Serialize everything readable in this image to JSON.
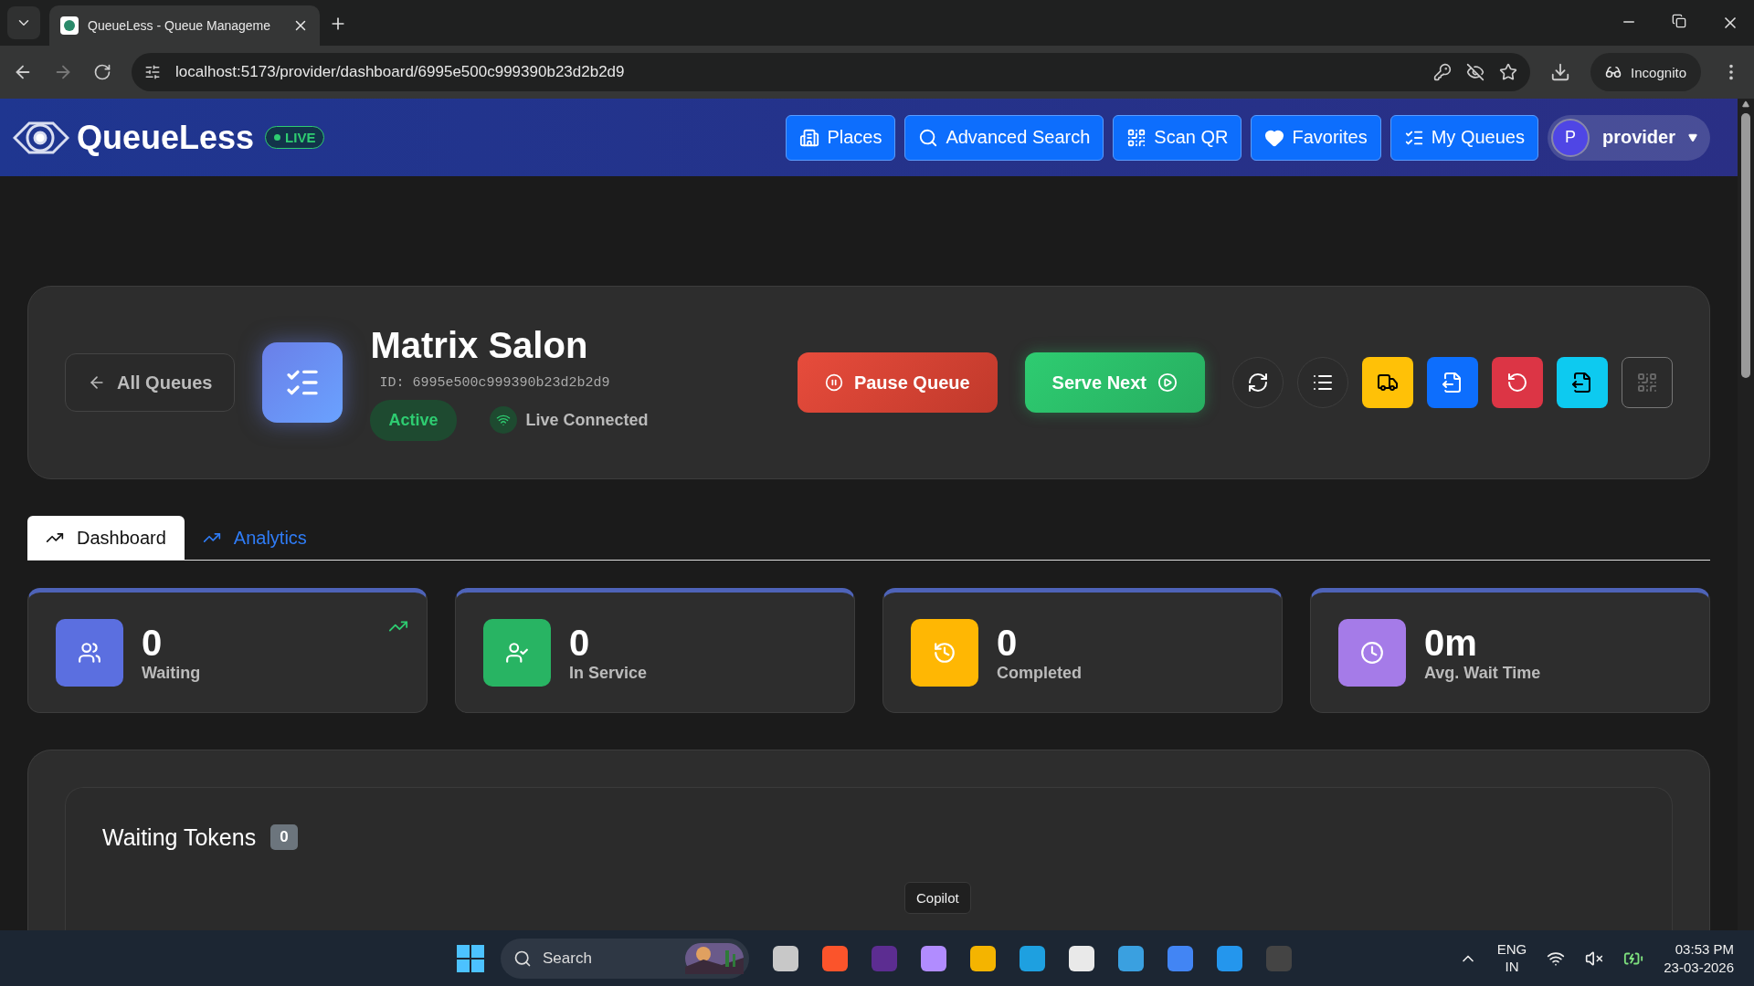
{
  "browser": {
    "tab_title": "QueueLess - Queue Manageme",
    "url": "localhost:5173/provider/dashboard/6995e500c999390b23d2b2d9",
    "profile": "Incognito"
  },
  "navbar": {
    "brand": "QueueLess",
    "badge": "LIVE",
    "buttons": [
      "Places",
      "Advanced Search",
      "Scan QR",
      "Favorites",
      "My Queues"
    ],
    "user_initial": "P",
    "user_name": "provider"
  },
  "queue": {
    "back": "All Queues",
    "name": "Matrix Salon",
    "id": "ID: 6995e500c999390b23d2b2d9",
    "status": "Active",
    "connection": "Live Connected",
    "pause": "Pause Queue",
    "serve": "Serve Next",
    "tools": [
      {
        "kind": "round",
        "color": "#2b2b2b"
      },
      {
        "kind": "round",
        "color": "#2b2b2b"
      },
      {
        "kind": "square",
        "color": "#ffc107"
      },
      {
        "kind": "square",
        "color": "#0d6efd"
      },
      {
        "kind": "square",
        "color": "#dc3545"
      },
      {
        "kind": "square",
        "color": "#0dcaf0"
      },
      {
        "kind": "outline",
        "color": "#2b2b2b"
      }
    ]
  },
  "tabs": [
    {
      "label": "Dashboard",
      "selected": true
    },
    {
      "label": "Analytics",
      "selected": false
    }
  ],
  "stats": [
    {
      "value": "0",
      "label": "Waiting",
      "color": "#5b6fe0"
    },
    {
      "value": "0",
      "label": "In Service",
      "color": "#28b463"
    },
    {
      "value": "0",
      "label": "Completed",
      "color": "#ffb703"
    },
    {
      "value": "0m",
      "label": "Avg. Wait Time",
      "color": "#a57be8"
    }
  ],
  "waiting": {
    "title": "Waiting Tokens",
    "count": "0"
  },
  "tooltip": "Copilot",
  "taskbar": {
    "search": "Search",
    "lang": "ENG",
    "region": "IN",
    "time": "03:53 PM",
    "date": "23-03-2026"
  }
}
